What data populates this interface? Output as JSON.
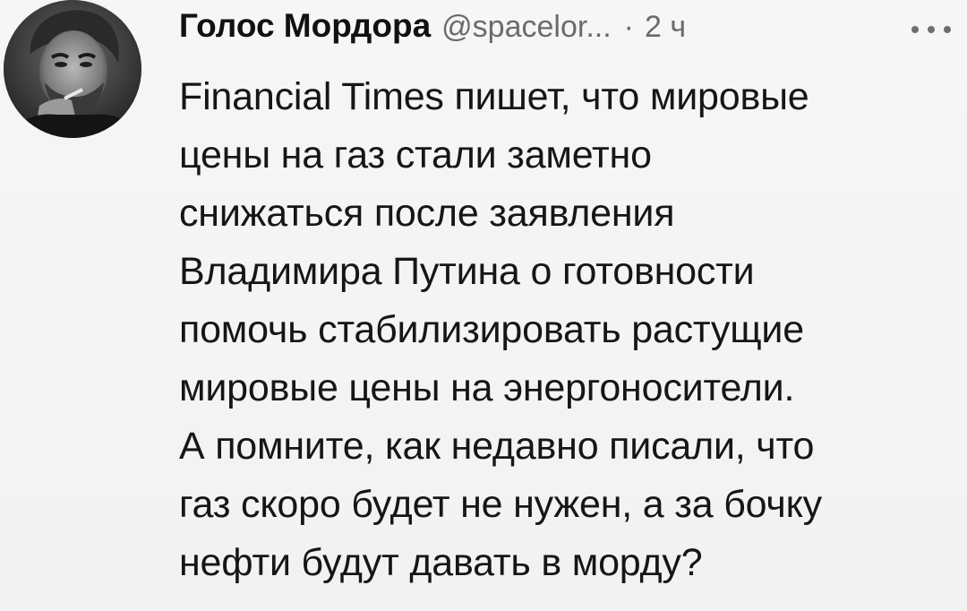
{
  "tweet": {
    "author": {
      "display_name": "Голос Мордора",
      "handle": "@spacelor...",
      "avatar_icon": "portrait-avatar"
    },
    "separator": "·",
    "time": "2 ч",
    "more_icon": "more-horizontal-icon",
    "text_lines": [
      "Financial Times пишет, что мировые",
      "цены на газ стали заметно",
      "снижаться после заявления",
      "Владимира Путина о готовности",
      "помочь стабилизировать растущие",
      "мировые цены на энергоносители.",
      "А помните, как недавно писали, что",
      "газ скоро будет не нужен, а за бочку",
      "нефти будут давать в морду?"
    ]
  }
}
